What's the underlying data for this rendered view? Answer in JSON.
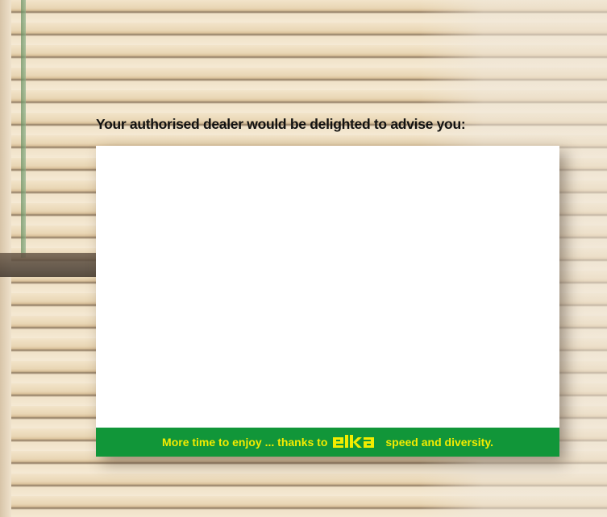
{
  "heading": "Your authorised dealer would be delighted to advise you:",
  "footer": {
    "before_brand": "More time to enjoy ... thanks to",
    "brand": "elka",
    "after_brand": "speed and diversity."
  },
  "colors": {
    "band": "#119639",
    "band_text": "#f3ec00",
    "card": "#ffffff"
  }
}
